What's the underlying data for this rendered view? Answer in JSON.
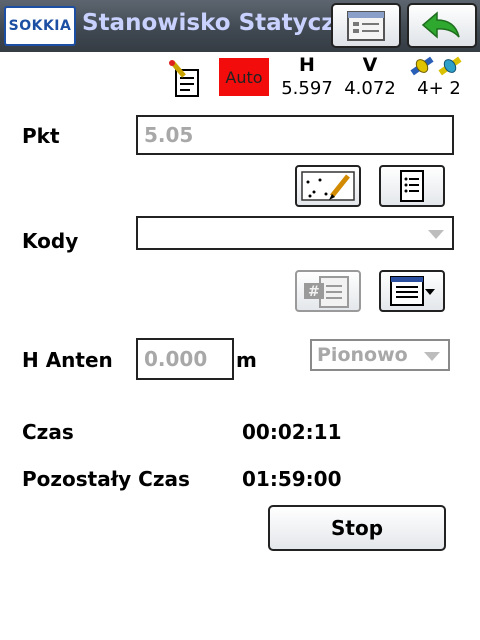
{
  "app": {
    "logo_text": "SOKKIA",
    "title": "Stanowisko Statycz"
  },
  "status": {
    "mode": "Auto",
    "h_label": "H",
    "h_value": "5.597",
    "v_label": "V",
    "v_value": "4.072",
    "sat_value": "4+ 2"
  },
  "form": {
    "pkt_label": "Pkt",
    "pkt_value": "5.05",
    "kody_label": "Kody",
    "kody_value": "",
    "h_anten_label": "H Anten",
    "h_anten_value": "0.000",
    "h_anten_unit": "m",
    "method_value": "Pionowo"
  },
  "timing": {
    "czas_label": "Czas",
    "czas_value": "00:02:11",
    "pozostaly_label": "Pozostały Czas",
    "pozostaly_value": "01:59:00"
  },
  "actions": {
    "stop_label": "Stop"
  },
  "colors": {
    "titlebar": "#3f4750",
    "title_text": "#c9d2ff",
    "auto_bg": "#f20c0c",
    "accent_back": "#2fa82f"
  }
}
